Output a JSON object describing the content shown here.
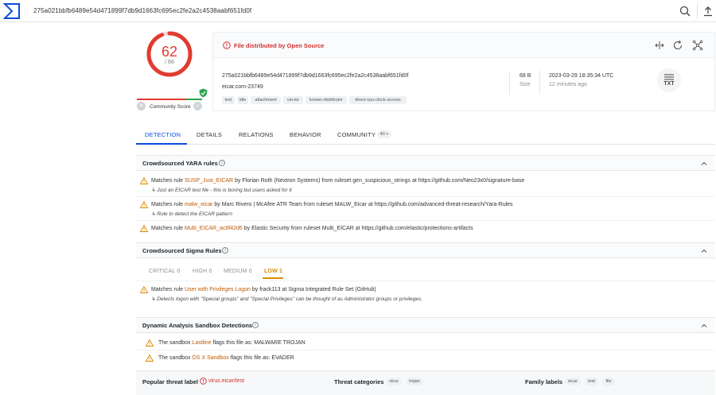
{
  "search": {
    "query": "275a021bbfb6489e54d471899f7db9d1663fc695ec2fe2a2c4538aabf651fd0f"
  },
  "score": {
    "detections": "62",
    "total": "/ 66",
    "community_label": "Community Score"
  },
  "file": {
    "alert": "File distributed by Open Source",
    "hash": "275a021bbfb6489e54d471899f7db9d1663fc695ec2fe2a2c4538aabf651fd0f",
    "name": "eicar.com-23749",
    "tags": [
      "text",
      "idle",
      "attachment",
      "via-tor",
      "known-distributor",
      "direct-cpu-clock-access"
    ],
    "size_value": "68 B",
    "size_label": "Size",
    "date_value": "2023-03-29 18:35:34 UTC",
    "date_label": "12 minutes ago",
    "type_icon_label": "TXT"
  },
  "tabs": [
    {
      "label": "DETECTION"
    },
    {
      "label": "DETAILS"
    },
    {
      "label": "RELATIONS"
    },
    {
      "label": "BEHAVIOR"
    },
    {
      "label": "COMMUNITY"
    }
  ],
  "community_count": "40 +",
  "yara": {
    "title": "Crowdsourced YARA rules",
    "rows": [
      {
        "pre": "Matches rule ",
        "rule": "SUSP_Just_EICAR",
        "post": " by Florian Roth (Nextron Systems) from ruleset gen_suspicious_strings at https://github.com/Neo23x0/signature-base",
        "sub": "Just an EICAR test file - this is boring but users asked for it"
      },
      {
        "pre": "Matches rule ",
        "rule": "malw_eicar",
        "post": " by Marc Rivero | McAfee ATR Team from ruleset MALW_Eicar at https://github.com/advanced-threat-research/Yara-Rules",
        "sub": "Rule to detect the EICAR pattern"
      },
      {
        "pre": "Matches rule ",
        "rule": "Multi_EICAR_ac8f42d6",
        "post": " by Elastic Security from ruleset Multi_EICAR at https://github.com/elastic/protections-artifacts",
        "sub": ""
      }
    ]
  },
  "sigma": {
    "title": "Crowdsourced Sigma Rules",
    "severities": [
      "CRITICAL 0",
      "HIGH 0",
      "MEDIUM 0",
      "LOW 1"
    ],
    "row": {
      "pre": "Matches rule ",
      "rule": "User with Privileges Logon",
      "post": " by frack113 at Sigma Integrated Rule Set (GitHub)",
      "sub": "Detects logon with \"Special groups\" and \"Special Privileges\" can be thought of as Administrator groups or privileges."
    }
  },
  "sandbox": {
    "title": "Dynamic Analysis Sandbox Detections",
    "rows": [
      {
        "pre": "The sandbox ",
        "name": "Lastline",
        "post": " flags this file as: MALWARE TROJAN"
      },
      {
        "pre": "The sandbox ",
        "name": "OS X Sandbox",
        "post": " flags this file as: EVADER"
      }
    ]
  },
  "bottom": {
    "popular_label": "Popular threat label",
    "popular_value": "virus.eicar/test",
    "categories_label": "Threat categories",
    "categories": [
      "virus",
      "trojan"
    ],
    "family_label": "Family labels",
    "families": [
      "eicar",
      "test",
      "file"
    ]
  },
  "colors": {
    "accent": "#0b4dda",
    "danger": "#e03c31",
    "warning": "#e08a00",
    "link_orange": "#c05a00"
  }
}
